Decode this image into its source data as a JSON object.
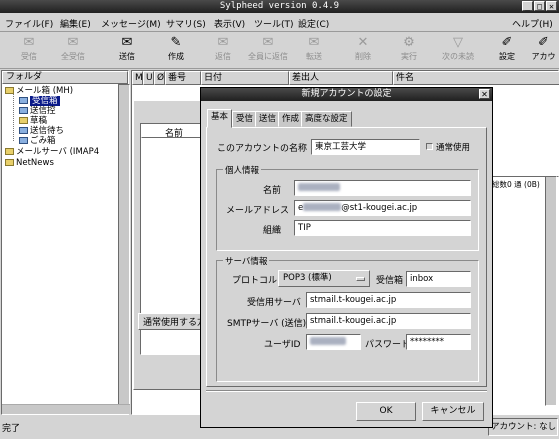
{
  "window": {
    "title": "Sylpheed version 0.4.9",
    "buttons": [
      "_",
      "□",
      "✕"
    ]
  },
  "menubar": [
    "ファイル(F)",
    "編集(E)",
    "メッセージ(M)",
    "サマリ(S)",
    "表示(V)",
    "ツール(T)",
    "設定(C)",
    "ヘルプ(H)"
  ],
  "toolbar": [
    {
      "label": "受信",
      "icon": "get-mail-icon",
      "enabled": false
    },
    {
      "label": "全受信",
      "icon": "get-all-mail-icon",
      "enabled": false
    },
    {
      "label": "送信",
      "icon": "send-icon",
      "enabled": true
    },
    {
      "label": "作成",
      "icon": "compose-icon",
      "enabled": true
    },
    {
      "label": "返信",
      "icon": "reply-icon",
      "enabled": false
    },
    {
      "label": "全員に返信",
      "icon": "reply-all-icon",
      "enabled": false
    },
    {
      "label": "転送",
      "icon": "forward-icon",
      "enabled": false
    },
    {
      "label": "削除",
      "icon": "delete-icon",
      "enabled": false
    },
    {
      "label": "実行",
      "icon": "execute-icon",
      "enabled": false
    },
    {
      "label": "次の未読",
      "icon": "next-unread-icon",
      "enabled": false
    },
    {
      "label": "設定",
      "icon": "prefs-icon",
      "enabled": true
    },
    {
      "label": "アカウ",
      "icon": "account-icon",
      "enabled": true
    }
  ],
  "folderpane": {
    "header": "フォルダ",
    "items": [
      {
        "label": "メール箱 (MH)",
        "selected": false
      },
      {
        "label": "受信箱",
        "selected": true
      },
      {
        "label": "送信控",
        "selected": false
      },
      {
        "label": "草稿",
        "selected": false
      },
      {
        "label": "送信待ち",
        "selected": false
      },
      {
        "label": "ごみ箱",
        "selected": false
      },
      {
        "label": "メールサーバ (IMAP4",
        "selected": false
      },
      {
        "label": "NetNews",
        "selected": false
      }
    ]
  },
  "summary": {
    "columns": [
      "M",
      "U",
      "Ø",
      "番号",
      "日付",
      "差出人",
      "件名"
    ],
    "count_label": "総数0 通 (0B)"
  },
  "background_dialog": {
    "column_label": "名前",
    "default_button": "通常使用する方"
  },
  "statusbar": {
    "left": "完了",
    "right": "アカウント: なし"
  },
  "dialog": {
    "title": "新規アカウントの設定",
    "tabs": [
      "基本",
      "受信",
      "送信",
      "作成",
      "高度な設定"
    ],
    "account_name_label": "このアカウントの名称",
    "account_name_value": "東京工芸大学",
    "default_checkbox": "通常使用",
    "personal_section": "個人情報",
    "name_label": "名前",
    "email_label": "メールアドレス",
    "email_prefix": "e",
    "email_suffix": "@st1-kougei.ac.jp",
    "org_label": "組織",
    "org_value": "TIP",
    "server_section": "サーバ情報",
    "protocol_label": "プロトコル",
    "protocol_value": "POP3 (標準)",
    "inbox_label": "受信箱",
    "inbox_value": "inbox",
    "recv_server_label": "受信用サーバ",
    "recv_server_value": "stmail.t-kougei.ac.jp",
    "smtp_label": "SMTPサーバ (送信)",
    "smtp_value": "stmail.t-kougei.ac.jp",
    "userid_label": "ユーザID",
    "password_label": "パスワード",
    "password_value": "********",
    "ok": "OK",
    "cancel": "キャンセル"
  }
}
